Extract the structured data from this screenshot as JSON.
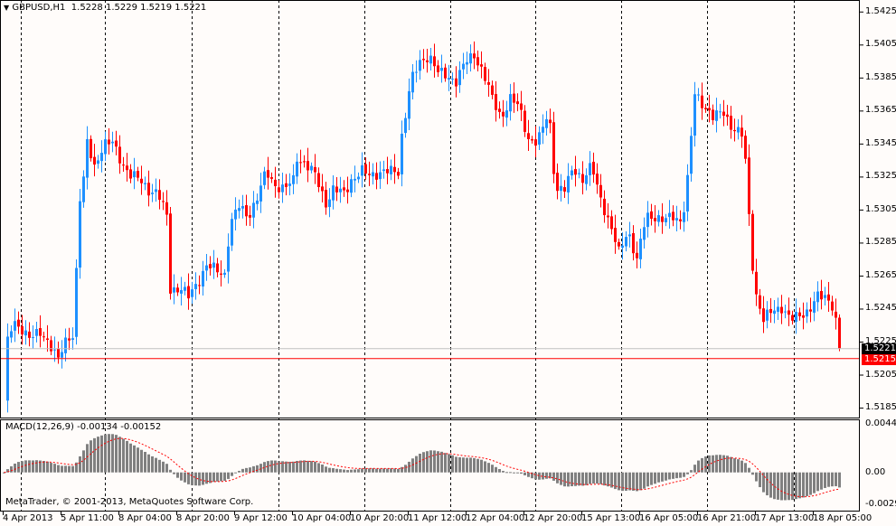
{
  "header": {
    "arrow_icon": "triangle-down-icon",
    "symbol": "GBPUSD,H1",
    "ohlc": "1.5228 1.5229 1.5219 1.5221"
  },
  "macd_label": "MACD(12,26,9) -0.00134 -0.00152",
  "copyright": "MetaTrader, © 2001-2013, MetaQuotes Software Corp.",
  "colors": {
    "bull": "#1e90ff",
    "bear": "#ff0000",
    "histogram": "#808080",
    "signal": "#ff0000",
    "bid_line": "#c0c0c0",
    "level_line": "#ff0000",
    "background": "#fffcfa"
  },
  "chart_data": {
    "type": "candlestick",
    "title": "GBPUSD,H1",
    "ylim": [
      1.5179,
      1.5432
    ],
    "price_ticks": [
      "1.5425",
      "1.5405",
      "1.5385",
      "1.5365",
      "1.5345",
      "1.5325",
      "1.5305",
      "1.5285",
      "1.5265",
      "1.5245",
      "1.5225",
      "1.5205",
      "1.5185"
    ],
    "bid": "1.5221",
    "level": "1.5215",
    "time_labels": [
      "4 Apr 2013",
      "5 Apr 11:00",
      "8 Apr 04:00",
      "8 Apr 20:00",
      "9 Apr 12:00",
      "10 Apr 04:00",
      "10 Apr 20:00",
      "11 Apr 12:00",
      "12 Apr 04:00",
      "12 Apr 20:00",
      "15 Apr 13:00",
      "16 Apr 05:00",
      "16 Apr 21:00",
      "17 Apr 13:00",
      "18 Apr 05:00"
    ],
    "close_keypoints": [
      [
        0,
        1.519
      ],
      [
        1,
        1.5225
      ],
      [
        2.5,
        1.5236
      ],
      [
        5,
        1.5233
      ],
      [
        7.5,
        1.5227
      ],
      [
        10,
        1.523
      ],
      [
        12.5,
        1.5225
      ],
      [
        15,
        1.5214
      ],
      [
        17.5,
        1.5227
      ],
      [
        19.5,
        1.523
      ],
      [
        20.5,
        1.5307
      ],
      [
        22,
        1.5323
      ],
      [
        23,
        1.5345
      ],
      [
        25,
        1.5331
      ],
      [
        27.5,
        1.5345
      ],
      [
        30,
        1.5345
      ],
      [
        32.5,
        1.5334
      ],
      [
        35,
        1.5326
      ],
      [
        37.5,
        1.5323
      ],
      [
        40,
        1.5317
      ],
      [
        42.5,
        1.5315
      ],
      [
        45,
        1.5301
      ],
      [
        46,
        1.5257
      ],
      [
        49,
        1.5257
      ],
      [
        51,
        1.5252
      ],
      [
        54,
        1.5263
      ],
      [
        56,
        1.5271
      ],
      [
        59,
        1.5268
      ],
      [
        61,
        1.5266
      ],
      [
        62.5,
        1.5296
      ],
      [
        65,
        1.5307
      ],
      [
        67.5,
        1.5301
      ],
      [
        70,
        1.5312
      ],
      [
        72.5,
        1.5328
      ],
      [
        75,
        1.532
      ],
      [
        77.5,
        1.5317
      ],
      [
        80,
        1.5323
      ],
      [
        81,
        1.5337
      ],
      [
        84,
        1.5331
      ],
      [
        86,
        1.5326
      ],
      [
        89,
        1.5309
      ],
      [
        91,
        1.5317
      ],
      [
        94,
        1.5315
      ],
      [
        96,
        1.5323
      ],
      [
        99,
        1.5328
      ],
      [
        101,
        1.5326
      ],
      [
        105,
        1.5328
      ],
      [
        109,
        1.5328
      ],
      [
        110,
        1.535
      ],
      [
        112.5,
        1.5383
      ],
      [
        115,
        1.5394
      ],
      [
        117.5,
        1.5399
      ],
      [
        120,
        1.5388
      ],
      [
        122.5,
        1.5386
      ],
      [
        125,
        1.5383
      ],
      [
        127.5,
        1.5394
      ],
      [
        130,
        1.5399
      ],
      [
        132.5,
        1.5388
      ],
      [
        135,
        1.5372
      ],
      [
        137.5,
        1.5361
      ],
      [
        140,
        1.5372
      ],
      [
        142.5,
        1.5367
      ],
      [
        145,
        1.5348
      ],
      [
        147.5,
        1.5345
      ],
      [
        150,
        1.5361
      ],
      [
        151,
        1.5356
      ],
      [
        152.5,
        1.5317
      ],
      [
        155,
        1.5317
      ],
      [
        157.5,
        1.5331
      ],
      [
        160,
        1.5323
      ],
      [
        162.5,
        1.5331
      ],
      [
        165,
        1.5312
      ],
      [
        167.5,
        1.5296
      ],
      [
        170,
        1.5279
      ],
      [
        172.5,
        1.5293
      ],
      [
        175,
        1.5274
      ],
      [
        177.5,
        1.5301
      ],
      [
        180,
        1.5301
      ],
      [
        182.5,
        1.5298
      ],
      [
        185,
        1.5301
      ],
      [
        187.5,
        1.5298
      ],
      [
        189,
        1.5323
      ],
      [
        191,
        1.5375
      ],
      [
        194,
        1.5367
      ],
      [
        196,
        1.5361
      ],
      [
        199,
        1.5364
      ],
      [
        201,
        1.5356
      ],
      [
        204,
        1.535
      ],
      [
        205,
        1.5334
      ],
      [
        206,
        1.5301
      ],
      [
        207.5,
        1.5257
      ],
      [
        210,
        1.5238
      ],
      [
        212.5,
        1.5244
      ],
      [
        215,
        1.5246
      ],
      [
        217.5,
        1.5238
      ],
      [
        220,
        1.5241
      ],
      [
        222.5,
        1.5244
      ],
      [
        225,
        1.5252
      ],
      [
        227.5,
        1.5252
      ],
      [
        229.5,
        1.5246
      ],
      [
        231,
        1.5221
      ]
    ],
    "macd": {
      "params": "12,26,9",
      "ylim": [
        -0.0036,
        0.0048
      ],
      "ticks": [
        "0.00443",
        "0.00",
        "-0.0029"
      ],
      "tick_values": [
        0.00443,
        0,
        -0.0029
      ]
    }
  }
}
